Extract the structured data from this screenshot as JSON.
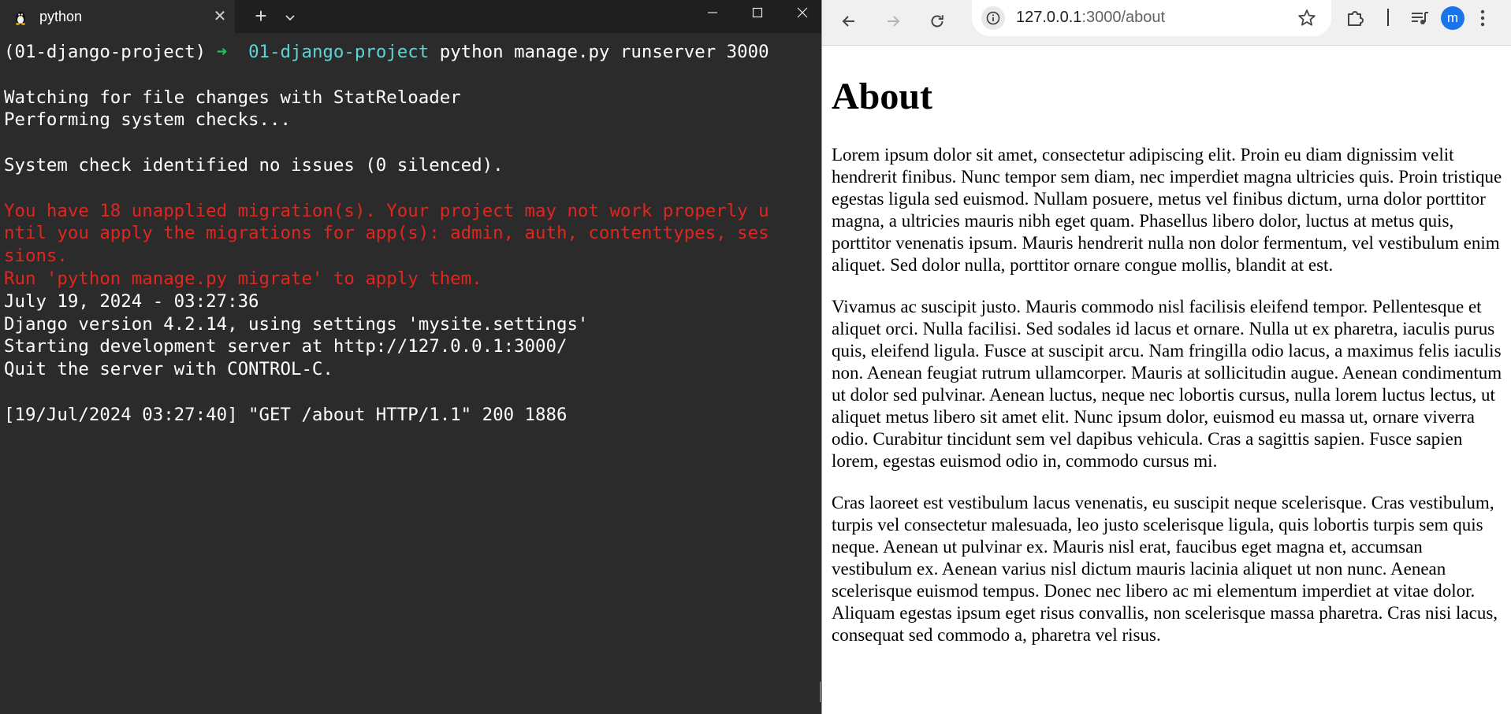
{
  "terminal": {
    "tab_title": "python",
    "tab_icon": "linux-penguin-icon",
    "lines": [
      [
        {
          "t": "(01-django-project) ",
          "c": "white"
        },
        {
          "t": "➜  ",
          "c": "green"
        },
        {
          "t": "01-django-project",
          "c": "cyan"
        },
        {
          "t": " python manage.py runserver 3000",
          "c": "white"
        }
      ],
      [],
      [
        {
          "t": "Watching for file changes with StatReloader",
          "c": "white"
        }
      ],
      [
        {
          "t": "Performing system checks...",
          "c": "white"
        }
      ],
      [],
      [
        {
          "t": "System check identified no issues (0 silenced).",
          "c": "white"
        }
      ],
      [],
      [
        {
          "t": "You have 18 unapplied migration(s). Your project may not work properly u",
          "c": "red"
        }
      ],
      [
        {
          "t": "ntil you apply the migrations for app(s): admin, auth, contenttypes, ses",
          "c": "red"
        }
      ],
      [
        {
          "t": "sions.",
          "c": "red"
        }
      ],
      [
        {
          "t": "Run 'python manage.py migrate' to apply them.",
          "c": "red"
        }
      ],
      [
        {
          "t": "July 19, 2024 - 03:27:36",
          "c": "white"
        }
      ],
      [
        {
          "t": "Django version 4.2.14, using settings 'mysite.settings'",
          "c": "white"
        }
      ],
      [
        {
          "t": "Starting development server at http://127.0.0.1:3000/",
          "c": "white"
        }
      ],
      [
        {
          "t": "Quit the server with CONTROL-C.",
          "c": "white"
        }
      ],
      [],
      [
        {
          "t": "[19/Jul/2024 03:27:40] \"GET /about HTTP/1.1\" 200 1886",
          "c": "white"
        }
      ]
    ]
  },
  "browser": {
    "url_host": "127.0.0.1",
    "url_path": ":3000/about",
    "profile_initial": "m",
    "page": {
      "heading": "About",
      "paragraphs": [
        "Lorem ipsum dolor sit amet, consectetur adipiscing elit. Proin eu diam dignissim velit hendrerit finibus. Nunc tempor sem diam, nec imperdiet magna ultricies quis. Proin tristique egestas ligula sed euismod. Nullam posuere, metus vel finibus dictum, urna dolor porttitor magna, a ultricies mauris nibh eget quam. Phasellus libero dolor, luctus at metus quis, porttitor venenatis ipsum. Mauris hendrerit nulla non dolor fermentum, vel vestibulum enim aliquet. Sed dolor nulla, porttitor ornare congue mollis, blandit at est.",
        "Vivamus ac suscipit justo. Mauris commodo nisl facilisis eleifend tempor. Pellentesque et aliquet orci. Nulla facilisi. Sed sodales id lacus et ornare. Nulla ut ex pharetra, iaculis purus quis, eleifend ligula. Fusce at suscipit arcu. Nam fringilla odio lacus, a maximus felis iaculis non. Aenean feugiat rutrum ullamcorper. Mauris at sollicitudin augue. Aenean condimentum ut dolor sed pulvinar. Aenean luctus, neque nec lobortis cursus, nulla lorem luctus lectus, ut aliquet metus libero sit amet elit. Nunc ipsum dolor, euismod eu massa ut, ornare viverra odio. Curabitur tincidunt sem vel dapibus vehicula. Cras a sagittis sapien. Fusce sapien lorem, egestas euismod odio in, commodo cursus mi.",
        "Cras laoreet est vestibulum lacus venenatis, eu suscipit neque scelerisque. Cras vestibulum, turpis vel consectetur malesuada, leo justo scelerisque ligula, quis lobortis turpis sem quis neque. Aenean ut pulvinar ex. Mauris nisl erat, faucibus eget magna et, accumsan vestibulum ex. Aenean varius nisl dictum mauris lacinia aliquet ut non nunc. Aenean scelerisque euismod tempus. Donec nec libero ac mi elementum imperdiet at vitae dolor. Aliquam egestas ipsum eget risus convallis, non scelerisque massa pharetra. Cras nisi lacus, consequat sed commodo a, pharetra vel risus."
      ]
    }
  },
  "colors": {
    "terminal_bg": "#2b2b2b",
    "terminal_red": "#e0261f",
    "terminal_green": "#21c35f",
    "terminal_cyan": "#5ed3d3",
    "avatar_blue": "#1a73e8"
  }
}
